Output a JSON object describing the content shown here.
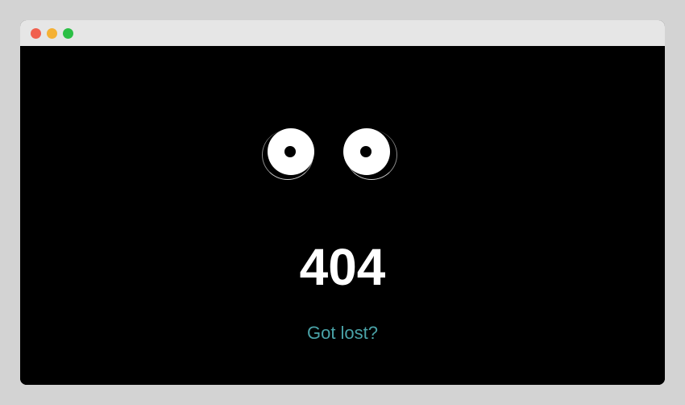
{
  "window": {
    "controls": [
      "close",
      "minimize",
      "maximize"
    ],
    "colors": {
      "close": "#f0604f",
      "minimize": "#f5b134",
      "maximize": "#2bbf45",
      "titlebar": "#e6e6e6"
    }
  },
  "page": {
    "background": "#000000",
    "error_code": "404",
    "message": "Got lost?",
    "message_color": "#4aa3a8",
    "illustration": "eyes-icon"
  }
}
